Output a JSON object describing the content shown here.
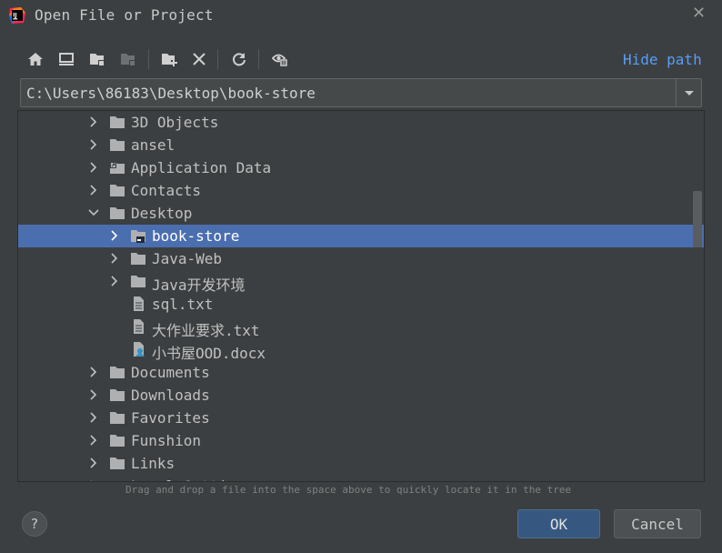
{
  "window": {
    "title": "Open File or Project"
  },
  "toolbar": {
    "buttons": [
      {
        "icon": "home-icon"
      },
      {
        "icon": "desktop-icon"
      },
      {
        "icon": "project-folder-icon"
      },
      {
        "icon": "module-folder-icon"
      },
      {
        "icon": "new-folder-icon"
      },
      {
        "icon": "delete-icon"
      },
      {
        "icon": "refresh-icon"
      },
      {
        "icon": "show-hidden-icon"
      }
    ],
    "hide_path_label": "Hide path"
  },
  "path": {
    "value": "C:\\Users\\86183\\Desktop\\book-store"
  },
  "tree": {
    "rows": [
      {
        "label": "3D Objects",
        "icon": "folder-icon",
        "expander": "collapsed",
        "level": 1
      },
      {
        "label": "ansel",
        "icon": "folder-icon",
        "expander": "collapsed",
        "level": 1
      },
      {
        "label": "Application Data",
        "icon": "folder-link-icon",
        "expander": "collapsed",
        "level": 1
      },
      {
        "label": "Contacts",
        "icon": "folder-icon",
        "expander": "collapsed",
        "level": 1
      },
      {
        "label": "Desktop",
        "icon": "folder-icon",
        "expander": "expanded",
        "level": 1
      },
      {
        "label": "book-store",
        "icon": "project-folder-icon",
        "expander": "collapsed",
        "level": 2,
        "selected": true
      },
      {
        "label": "Java-Web",
        "icon": "folder-icon",
        "expander": "collapsed",
        "level": 2
      },
      {
        "label": "Java开发环境",
        "icon": "folder-icon",
        "expander": "collapsed",
        "level": 2
      },
      {
        "label": "sql.txt",
        "icon": "text-file-icon",
        "expander": "none",
        "level": 2
      },
      {
        "label": "大作业要求.txt",
        "icon": "text-file-icon",
        "expander": "none",
        "level": 2
      },
      {
        "label": "小书屋OOD.docx",
        "icon": "docx-file-icon",
        "expander": "none",
        "level": 2
      },
      {
        "label": "Documents",
        "icon": "folder-icon",
        "expander": "collapsed",
        "level": 1
      },
      {
        "label": "Downloads",
        "icon": "folder-icon",
        "expander": "collapsed",
        "level": 1
      },
      {
        "label": "Favorites",
        "icon": "folder-icon",
        "expander": "collapsed",
        "level": 1
      },
      {
        "label": "Funshion",
        "icon": "folder-icon",
        "expander": "collapsed",
        "level": 1
      },
      {
        "label": "Links",
        "icon": "folder-icon",
        "expander": "collapsed",
        "level": 1
      },
      {
        "label": "Local Settings",
        "icon": "folder-link-icon",
        "expander": "collapsed",
        "level": 1
      }
    ]
  },
  "hint": "Drag and drop a file into the space above to quickly locate it in the tree",
  "buttons": {
    "help_label": "?",
    "ok_label": "OK",
    "cancel_label": "Cancel"
  },
  "colors": {
    "background": "#3c3f41",
    "selection": "#4b6eaf",
    "link": "#589df6",
    "ok_button": "#365880"
  }
}
